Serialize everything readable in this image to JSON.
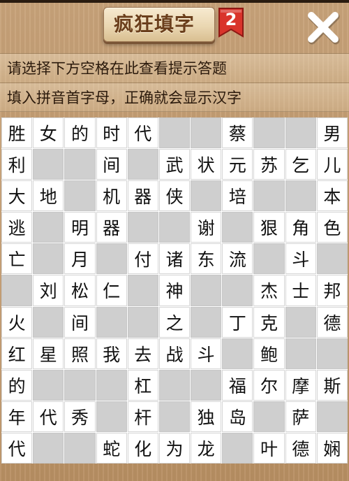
{
  "header": {
    "title": "疯狂填字",
    "badge": "2",
    "badge_color": "#d9342b",
    "close_icon": "close-icon"
  },
  "hints": [
    "请选择下方空格在此查看提示答题",
    "填入拼音首字母，正确就会显示汉字"
  ],
  "grid": {
    "rows": 11,
    "cols": 11,
    "cells": [
      [
        "胜",
        "女",
        "的",
        "时",
        "代",
        "",
        "",
        "蔡",
        "",
        "",
        "男"
      ],
      [
        "利",
        "",
        "",
        "间",
        "",
        "武",
        "状",
        "元",
        "苏",
        "乞",
        "儿"
      ],
      [
        "大",
        "地",
        "",
        "机",
        "器",
        "侠",
        "",
        "培",
        "",
        "",
        "本"
      ],
      [
        "逃",
        "",
        "明",
        "器",
        "",
        "",
        "谢",
        "",
        "狠",
        "角",
        "色"
      ],
      [
        "亡",
        "",
        "月",
        "",
        "付",
        "诸",
        "东",
        "流",
        "",
        "斗",
        ""
      ],
      [
        "",
        "刘",
        "松",
        "仁",
        "",
        "神",
        "",
        "",
        "杰",
        "士",
        "邦"
      ],
      [
        "火",
        "",
        "间",
        "",
        "",
        "之",
        "",
        "丁",
        "克",
        "",
        "德"
      ],
      [
        "红",
        "星",
        "照",
        "我",
        "去",
        "战",
        "斗",
        "",
        "鲍",
        "",
        ""
      ],
      [
        "的",
        "",
        "",
        "",
        "杠",
        "",
        "",
        "福",
        "尔",
        "摩",
        "斯"
      ],
      [
        "年",
        "代",
        "秀",
        "",
        "杆",
        "",
        "独",
        "岛",
        "",
        "萨",
        ""
      ],
      [
        "代",
        "",
        "",
        "蛇",
        "化",
        "为",
        "龙",
        "",
        "叶",
        "德",
        "娴"
      ]
    ]
  }
}
